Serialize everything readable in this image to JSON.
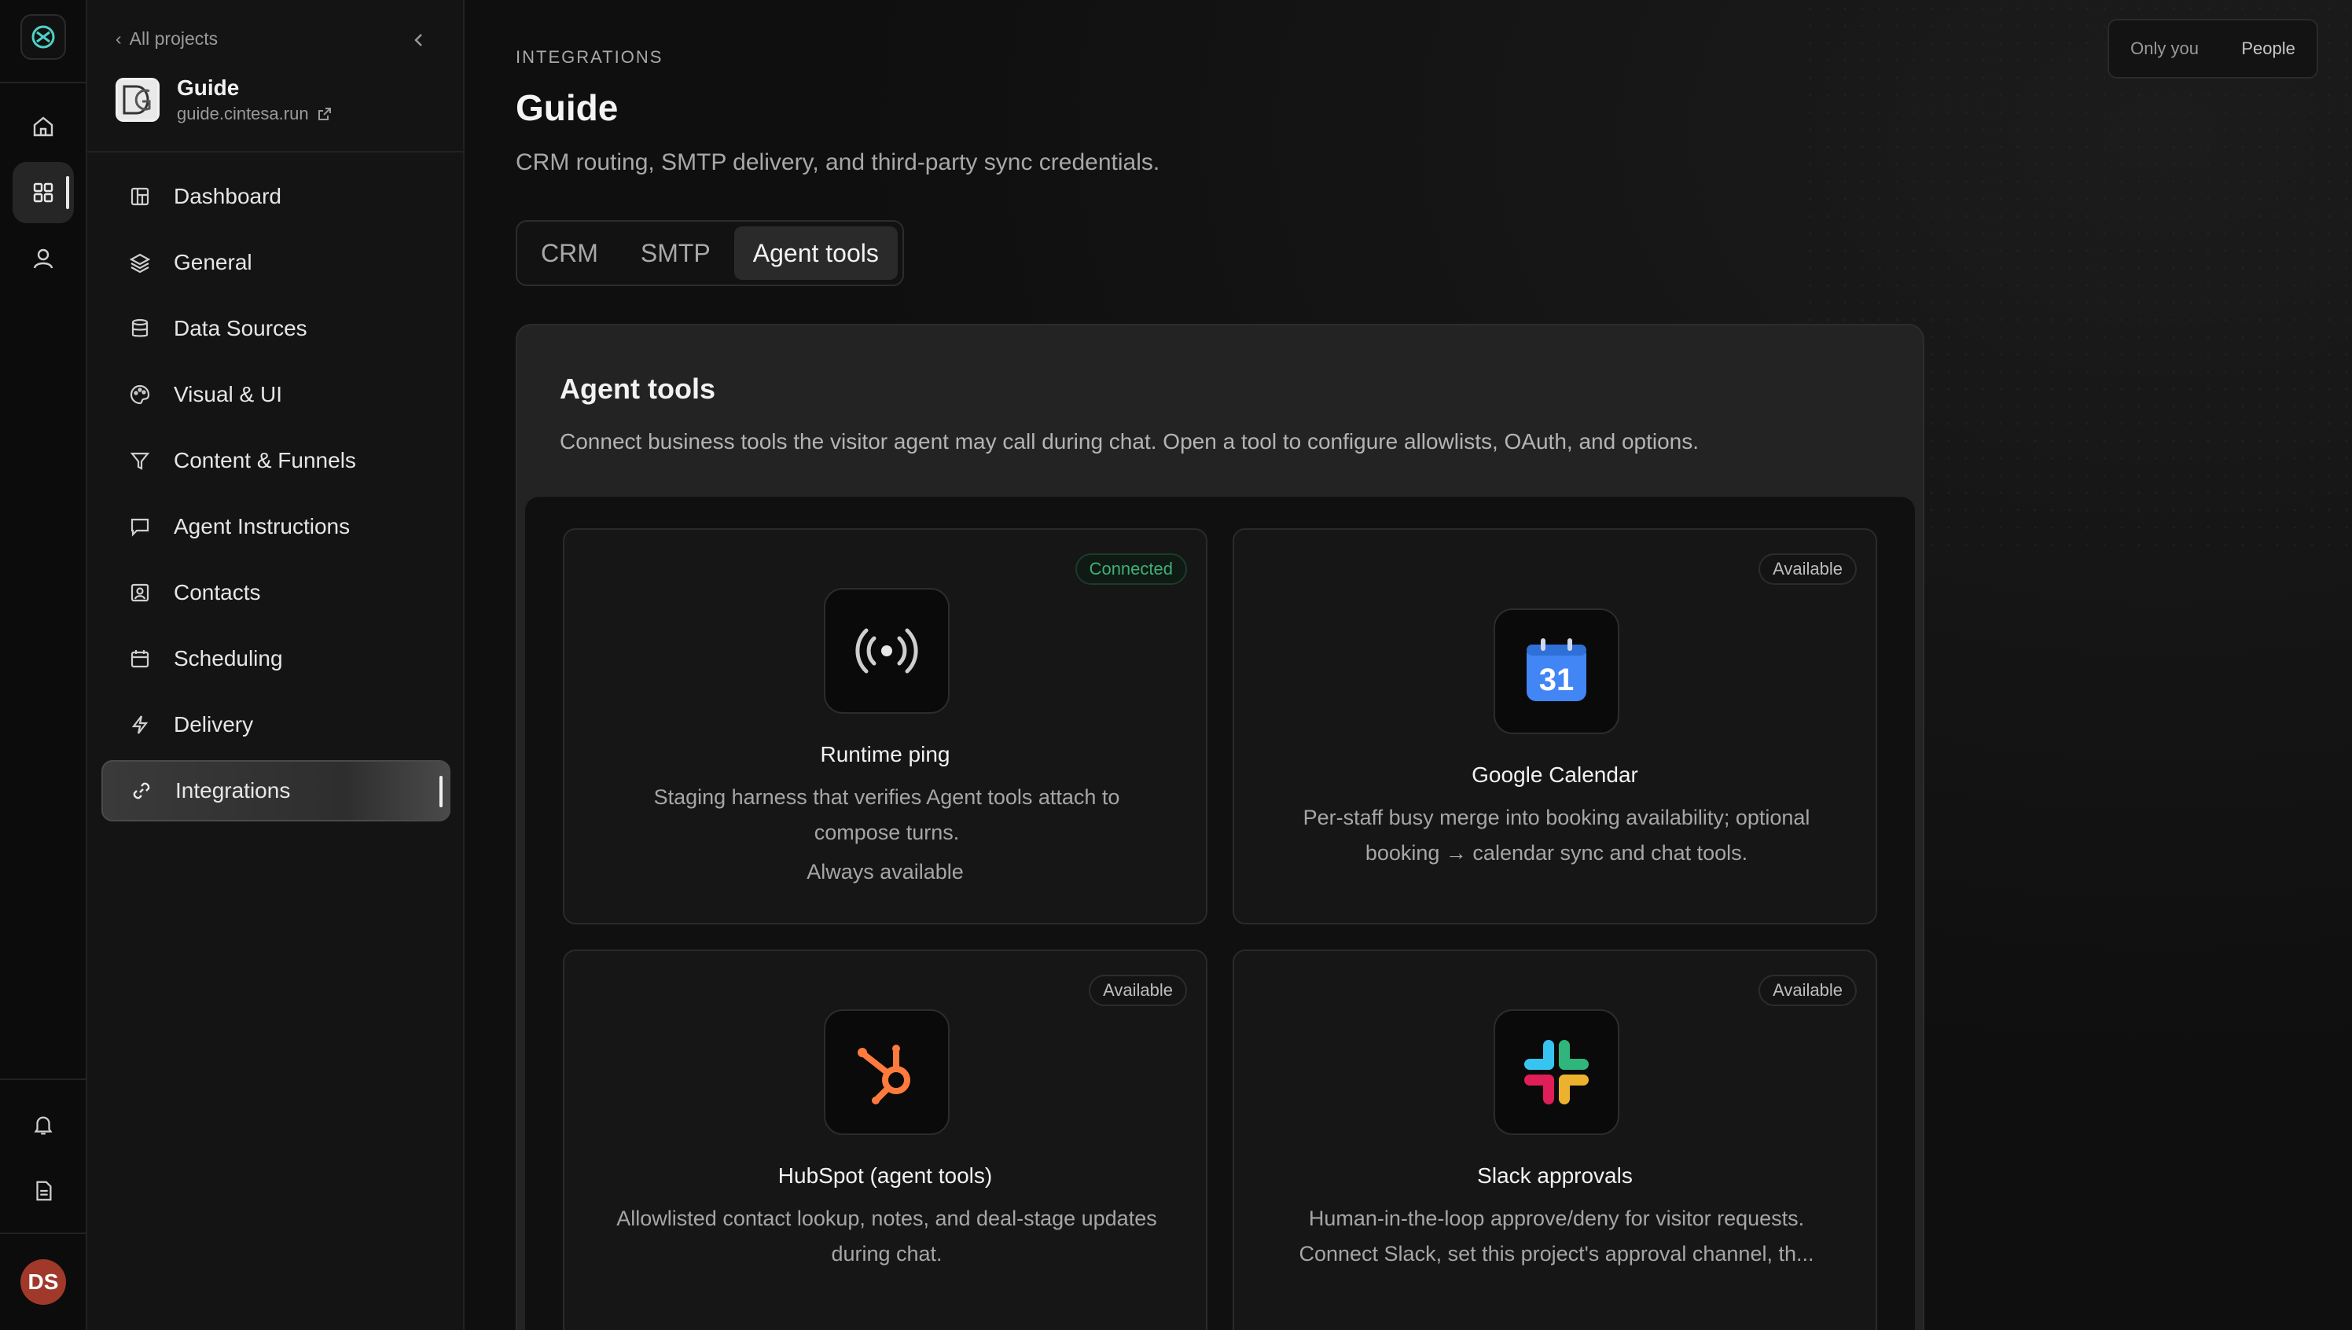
{
  "rail": {
    "items": [
      {
        "name": "home-icon"
      },
      {
        "name": "grid-icon"
      },
      {
        "name": "user-icon"
      }
    ],
    "bottom": [
      {
        "name": "bell-icon"
      },
      {
        "name": "document-icon"
      }
    ],
    "avatar_initials": "DS"
  },
  "sidebar": {
    "back_label": "All projects",
    "project_name": "Guide",
    "project_url": "guide.cintesa.run",
    "items": [
      {
        "label": "Dashboard",
        "icon": "dashboard-icon"
      },
      {
        "label": "General",
        "icon": "layers-icon"
      },
      {
        "label": "Data Sources",
        "icon": "database-icon"
      },
      {
        "label": "Visual & UI",
        "icon": "palette-icon"
      },
      {
        "label": "Content & Funnels",
        "icon": "funnel-icon"
      },
      {
        "label": "Agent Instructions",
        "icon": "chat-icon"
      },
      {
        "label": "Contacts",
        "icon": "contact-icon"
      },
      {
        "label": "Scheduling",
        "icon": "calendar-icon"
      },
      {
        "label": "Delivery",
        "icon": "bolt-icon"
      },
      {
        "label": "Integrations",
        "icon": "link-icon",
        "active": true
      }
    ]
  },
  "header": {
    "toggle": {
      "option_a": "Only you",
      "option_b": "People"
    },
    "eyebrow": "INTEGRATIONS",
    "title": "Guide",
    "subtitle": "CRM routing, SMTP delivery, and third-party sync credentials."
  },
  "tabs": [
    {
      "label": "CRM"
    },
    {
      "label": "SMTP"
    },
    {
      "label": "Agent tools",
      "active": true
    }
  ],
  "panel": {
    "title": "Agent tools",
    "description": "Connect business tools the visitor agent may call during chat. Open a tool to configure allowlists, OAuth, and options."
  },
  "tools": [
    {
      "name": "Runtime ping",
      "badge": "Connected",
      "icon": "broadcast-icon",
      "description": "Staging harness that verifies Agent tools attach to compose turns.",
      "extra": "Always available"
    },
    {
      "name": "Google Calendar",
      "badge": "Available",
      "icon": "google-calendar-icon",
      "icon_text": "31",
      "description": "Per-staff busy merge into booking availability; optional booking → calendar sync and chat tools."
    },
    {
      "name": "HubSpot (agent tools)",
      "badge": "Available",
      "icon": "hubspot-icon",
      "description": "Allowlisted contact lookup, notes, and deal-stage updates during chat."
    },
    {
      "name": "Slack approvals",
      "badge": "Available",
      "icon": "slack-icon",
      "description": "Human-in-the-loop approve/deny for visitor requests. Connect Slack, set this project's approval channel, th..."
    }
  ],
  "colors": {
    "accent_connected": "#3fae77",
    "hubspot": "#ff7a3d",
    "gcal_blue": "#4285f4",
    "avatar": "#a0392a"
  }
}
